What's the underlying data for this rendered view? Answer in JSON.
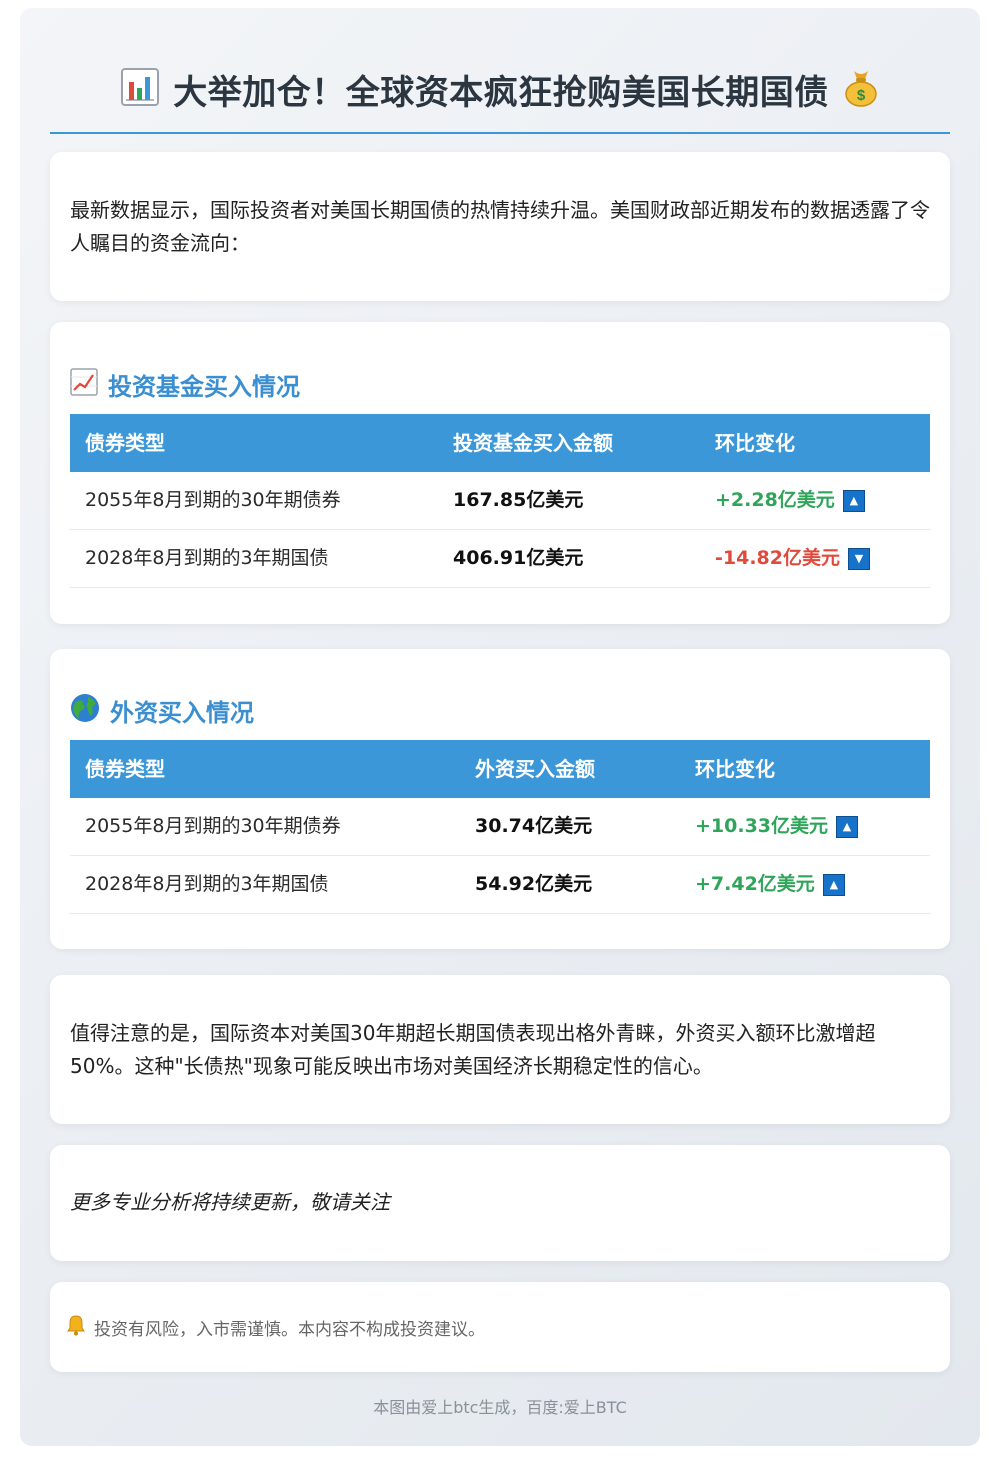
{
  "header": {
    "title": "大举加仓！全球资本疯狂抢购美国长期国债",
    "left_icon": "bar-chart-icon",
    "right_icon": "money-bag-icon"
  },
  "intro": {
    "text": "最新数据显示，国际投资者对美国长期国债的热情持续升温。美国财政部近期发布的数据透露了令人瞩目的资金流向："
  },
  "fund_section": {
    "icon": "trend-up-icon",
    "title": "投资基金买入情况",
    "headers": [
      "债券类型",
      "投资基金买入金额",
      "环比变化"
    ],
    "rows": [
      {
        "bond": "2055年8月到期的30年期债券",
        "amount": "167.85亿美元",
        "change": "+2.28亿美元",
        "direction": "up"
      },
      {
        "bond": "2028年8月到期的3年期国债",
        "amount": "406.91亿美元",
        "change": "-14.82亿美元",
        "direction": "down"
      }
    ]
  },
  "foreign_section": {
    "icon": "globe-icon",
    "title": "外资买入情况",
    "headers": [
      "债券类型",
      "外资买入金额",
      "环比变化"
    ],
    "rows": [
      {
        "bond": "2055年8月到期的30年期债券",
        "amount": "30.74亿美元",
        "change": "+10.33亿美元",
        "direction": "up"
      },
      {
        "bond": "2028年8月到期的3年期国债",
        "amount": "54.92亿美元",
        "change": "+7.42亿美元",
        "direction": "up"
      }
    ]
  },
  "note": {
    "text": "值得注意的是，国际资本对美国30年期超长期国债表现出格外青睐，外资买入额环比激增超50%。这种\"长债热\"现象可能反映出市场对美国经济长期稳定性的信心。"
  },
  "more": {
    "text": "更多专业分析将持续更新，敬请关注"
  },
  "disclaimer": {
    "icon": "bell-icon",
    "text": "投资有风险，入市需谨慎。本内容不构成投资建议。"
  },
  "footer": {
    "text": "本图由爱上btc生成，百度:爱上BTC"
  },
  "colors": {
    "accent": "#3b97d8",
    "up": "#2ea55a",
    "down": "#e04a3a",
    "title": "#2b3640"
  }
}
